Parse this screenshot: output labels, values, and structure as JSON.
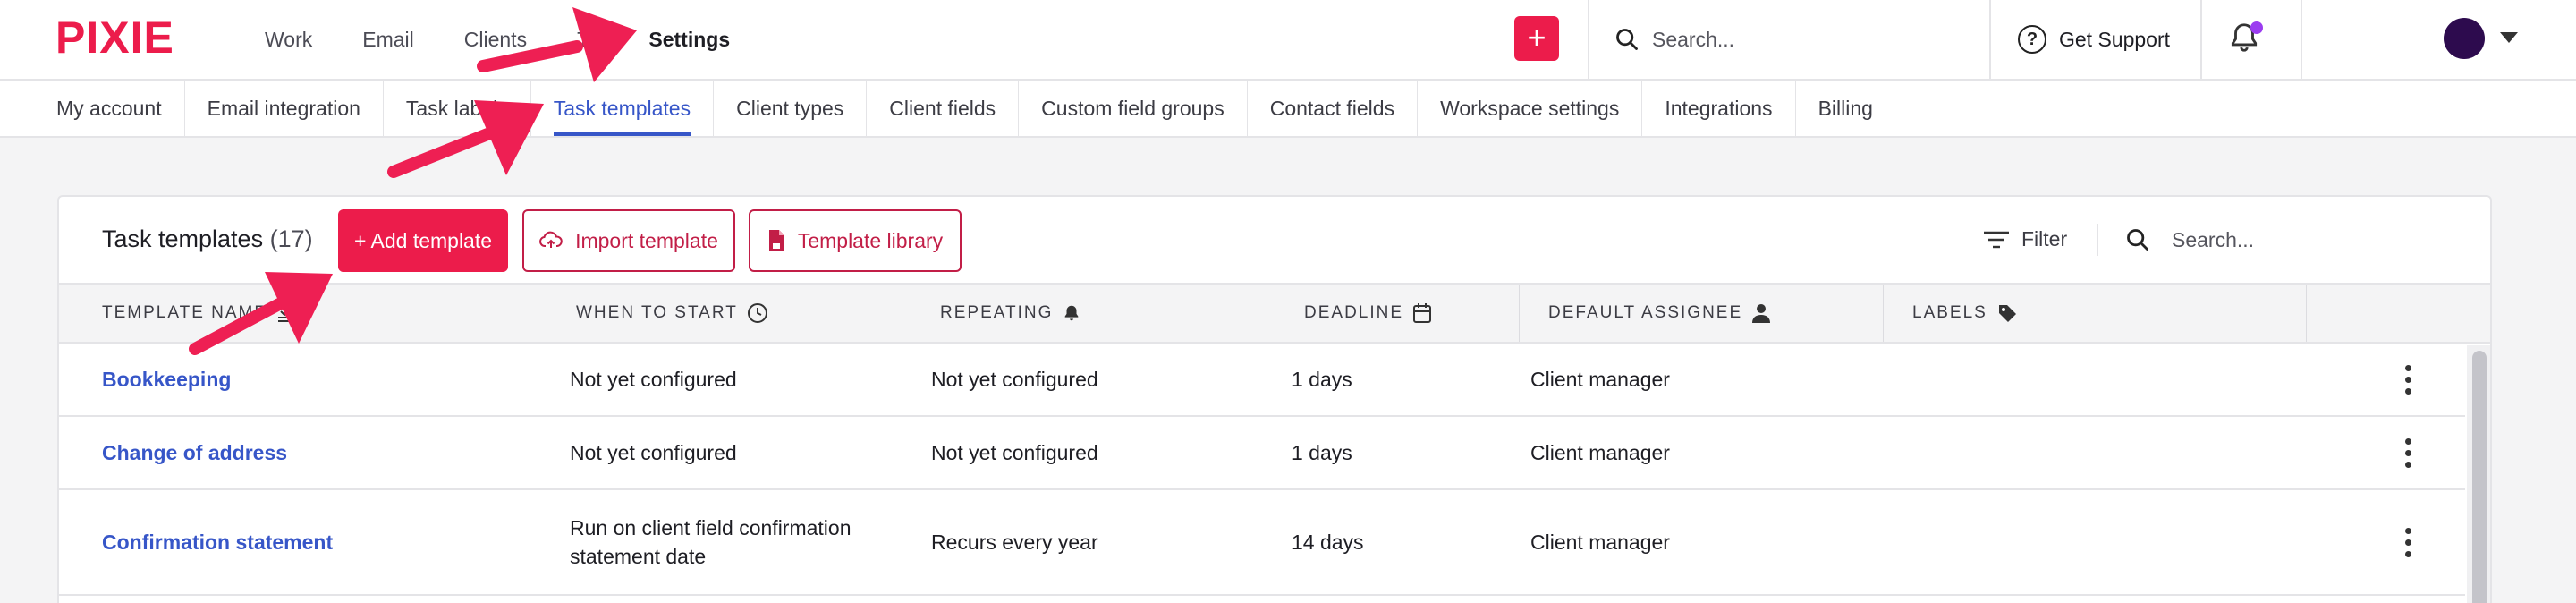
{
  "app": {
    "logo_text": "PIXIE",
    "brand_color": "#ec1c4b",
    "link_color": "#3756c8"
  },
  "topnav": {
    "items": [
      "Work",
      "Email",
      "Clients",
      "Te",
      "Settings"
    ],
    "active": "Settings",
    "add_icon": "plus-icon",
    "search_placeholder": "Search...",
    "support_label": "Get Support",
    "notification_icon": "bell-icon",
    "notification_dot_color": "#9b3cf0"
  },
  "settings_tabs": {
    "items": [
      "My account",
      "Email integration",
      "Task labels",
      "Task templates",
      "Client types",
      "Client fields",
      "Custom field groups",
      "Contact fields",
      "Workspace settings",
      "Integrations",
      "Billing"
    ],
    "active": "Task templates"
  },
  "panel": {
    "title": "Task templates",
    "count": "(17)",
    "add_button": "+ Add template",
    "import_button": "Import template",
    "library_button": "Template library",
    "filter_label": "Filter",
    "search_placeholder": "Search..."
  },
  "table": {
    "columns": [
      {
        "label": "TEMPLATE NAME",
        "icon": "sort-icon"
      },
      {
        "label": "WHEN TO START",
        "icon": "clock-icon"
      },
      {
        "label": "REPEATING",
        "icon": "bell-icon"
      },
      {
        "label": "DEADLINE",
        "icon": "calendar-icon"
      },
      {
        "label": "DEFAULT ASSIGNEE",
        "icon": "person-icon"
      },
      {
        "label": "LABELS",
        "icon": "tag-icon"
      }
    ],
    "rows": [
      {
        "name": "Bookkeeping",
        "when": "Not yet configured",
        "repeating": "Not yet configured",
        "deadline": "1 days",
        "assignee": "Client manager",
        "labels": ""
      },
      {
        "name": "Change of address",
        "when": "Not yet configured",
        "repeating": "Not yet configured",
        "deadline": "1 days",
        "assignee": "Client manager",
        "labels": ""
      },
      {
        "name": "Confirmation statement",
        "when": "Run on client field confirmation statement date",
        "repeating": "Recurs every year",
        "deadline": "14 days",
        "assignee": "Client manager",
        "labels": ""
      }
    ]
  },
  "annotations": {
    "arrow_color": "#ee1f53",
    "count": 3
  }
}
